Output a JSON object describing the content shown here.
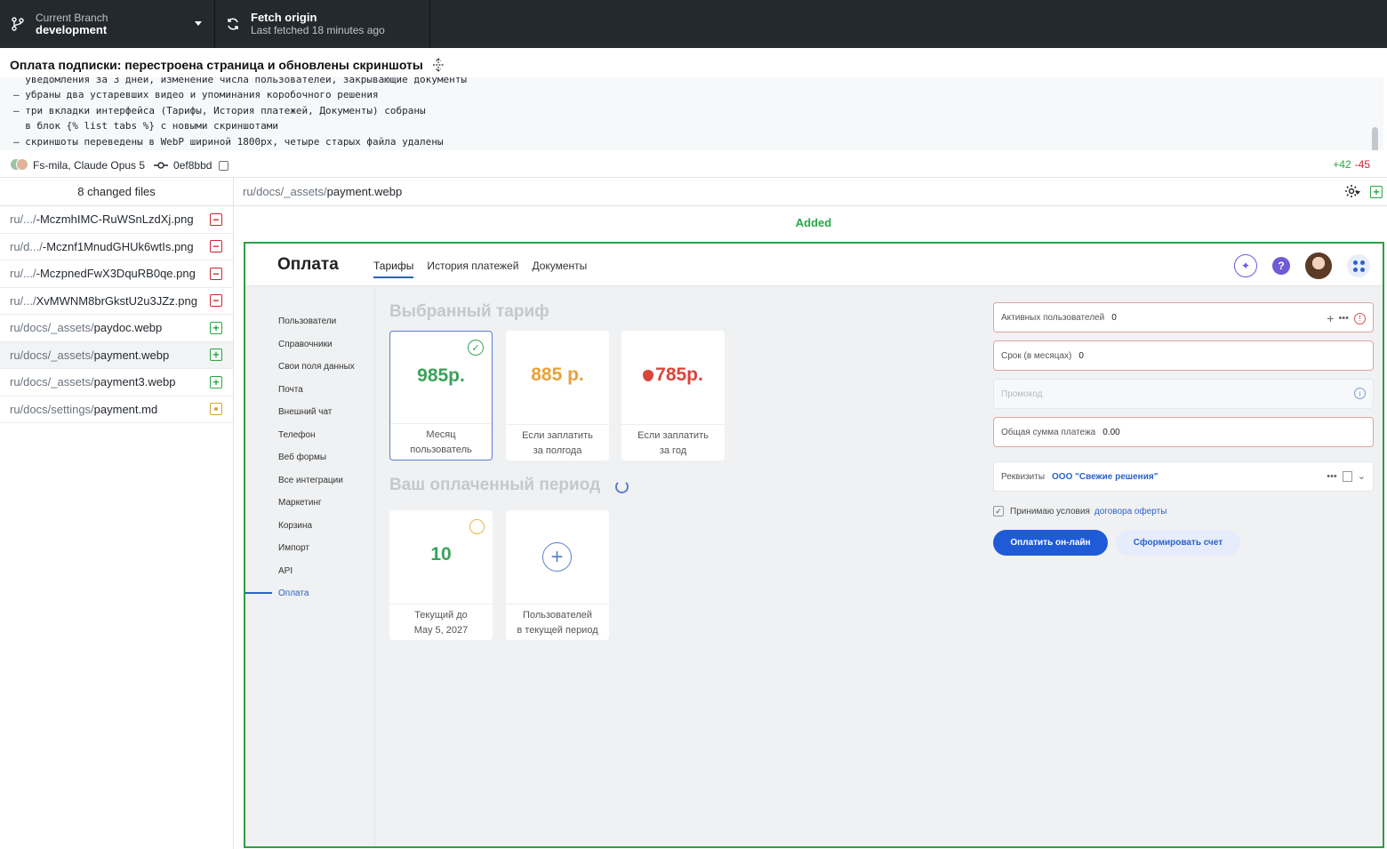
{
  "toolbar": {
    "branch_label": "Current Branch",
    "branch_name": "development",
    "fetch_label": "Fetch origin",
    "fetch_status": "Last fetched 18 minutes ago"
  },
  "commit": {
    "title": "Оплата подписки: перестроена страница и обновлены скриншоты",
    "body": "  уведомления за 3 дней, изменение числа пользователей, закрывающие документы\n– убраны два устаревших видео и упоминания коробочного решения\n– три вкладки интерфейса (Тарифы, История платежей, Документы) собраны\n  в блок {% list tabs %} с новыми скриншотами\n– скриншоты переведены в WebP шириной 1800px, четыре старых файла удалены",
    "authors": "Fs-mila, Claude Opus 5",
    "sha": "0ef8bbd",
    "additions": "+42",
    "deletions": "-45"
  },
  "sidebar": {
    "header": "8 changed files",
    "files": [
      {
        "dim": "ru/.../",
        "name": "-MczmhIMC-RuWSnLzdXj.png",
        "status": "deleted"
      },
      {
        "dim": "ru/d.../",
        "name": "-Mcznf1MnudGHUk6wtIs.png",
        "status": "deleted"
      },
      {
        "dim": "ru/.../",
        "name": "-MczpnedFwX3DquRB0qe.png",
        "status": "deleted"
      },
      {
        "dim": "ru/.../",
        "name": "XvMWNM8brGkstU2u3JZz.png",
        "status": "deleted"
      },
      {
        "dim": "ru/docs/_assets/",
        "name": "paydoc.webp",
        "status": "added"
      },
      {
        "dim": "ru/docs/_assets/",
        "name": "payment.webp",
        "status": "added"
      },
      {
        "dim": "ru/docs/_assets/",
        "name": "payment3.webp",
        "status": "added"
      },
      {
        "dim": "ru/docs/settings/",
        "name": "payment.md",
        "status": "modified"
      }
    ]
  },
  "diff": {
    "path_dim": "ru/docs/_assets/",
    "path_name": "payment.webp",
    "status_label": "Added"
  },
  "preview": {
    "title": "Оплата",
    "tabs": [
      "Тарифы",
      "История платежей",
      "Документы"
    ],
    "nav": [
      "Пользователи",
      "Справочники",
      "Свои поля данных",
      "Почта",
      "Внешний чат",
      "Телефон",
      "Веб формы",
      "Все интеграции",
      "Маркетинг",
      "Корзина",
      "Импорт",
      "API",
      "Оплата"
    ],
    "section_tariff": "Выбранный тариф",
    "tariffs": [
      {
        "price": "985р.",
        "line1": "Месяц",
        "line2": "пользователь",
        "color": "#3aa35a"
      },
      {
        "price": "885 р.",
        "line1": "Если заплатить",
        "line2": "за полгода",
        "color": "#e8a23a"
      },
      {
        "price": "785р.",
        "line1": "Если заплатить",
        "line2": "за год",
        "color": "#d9453b"
      }
    ],
    "section_period": "Ваш оплаченный период",
    "period_cards": [
      {
        "value": "10",
        "line1": "Текущий до",
        "line2": "May 5, 2027"
      },
      {
        "line1": "Пользователей",
        "line2": "в текущей период"
      }
    ],
    "fields": {
      "active_users_label": "Активных пользователей",
      "active_users_value": "0",
      "term_label": "Срок (в месяцах)",
      "term_value": "0",
      "promo_placeholder": "Промокод",
      "total_label": "Общая сумма платежа",
      "total_value": "0.00",
      "requisites_label": "Реквизиты",
      "requisites_value": "ООО \"Свежие решения\""
    },
    "agree_text": "Принимаю условия",
    "agree_link": "договора оферты",
    "pay_button": "Оплатить он-лайн",
    "invoice_button": "Сформировать счет"
  }
}
